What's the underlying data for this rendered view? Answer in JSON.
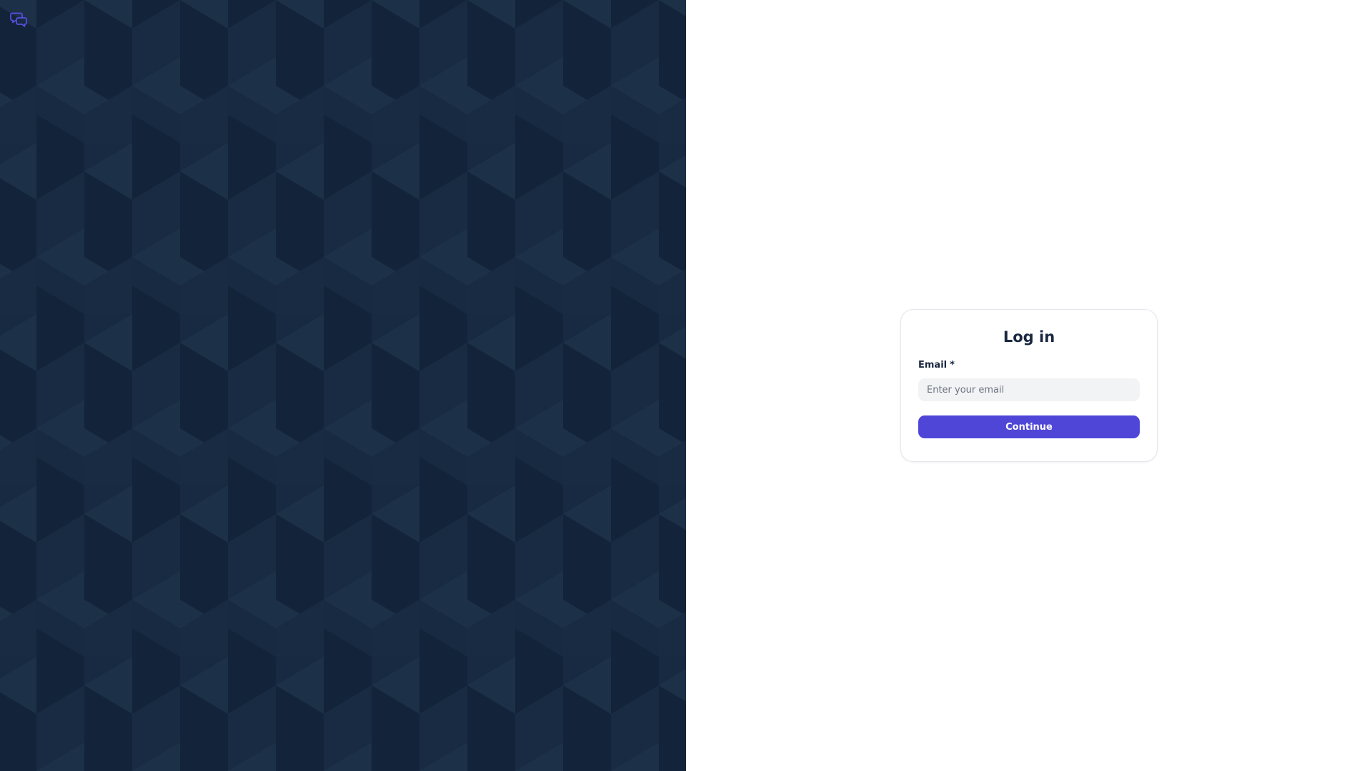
{
  "brand": {
    "logo_icon": "chat-bubbles-icon",
    "logo_color": "#5b4ee6"
  },
  "left_panel": {
    "background_color": "#172a42",
    "pattern": "isometric-cubes"
  },
  "login": {
    "title": "Log in",
    "email_label": "Email",
    "required_marker": "*",
    "email_placeholder": "Enter your email",
    "email_value": "",
    "continue_label": "Continue",
    "accent_color": "#4f46d8"
  }
}
